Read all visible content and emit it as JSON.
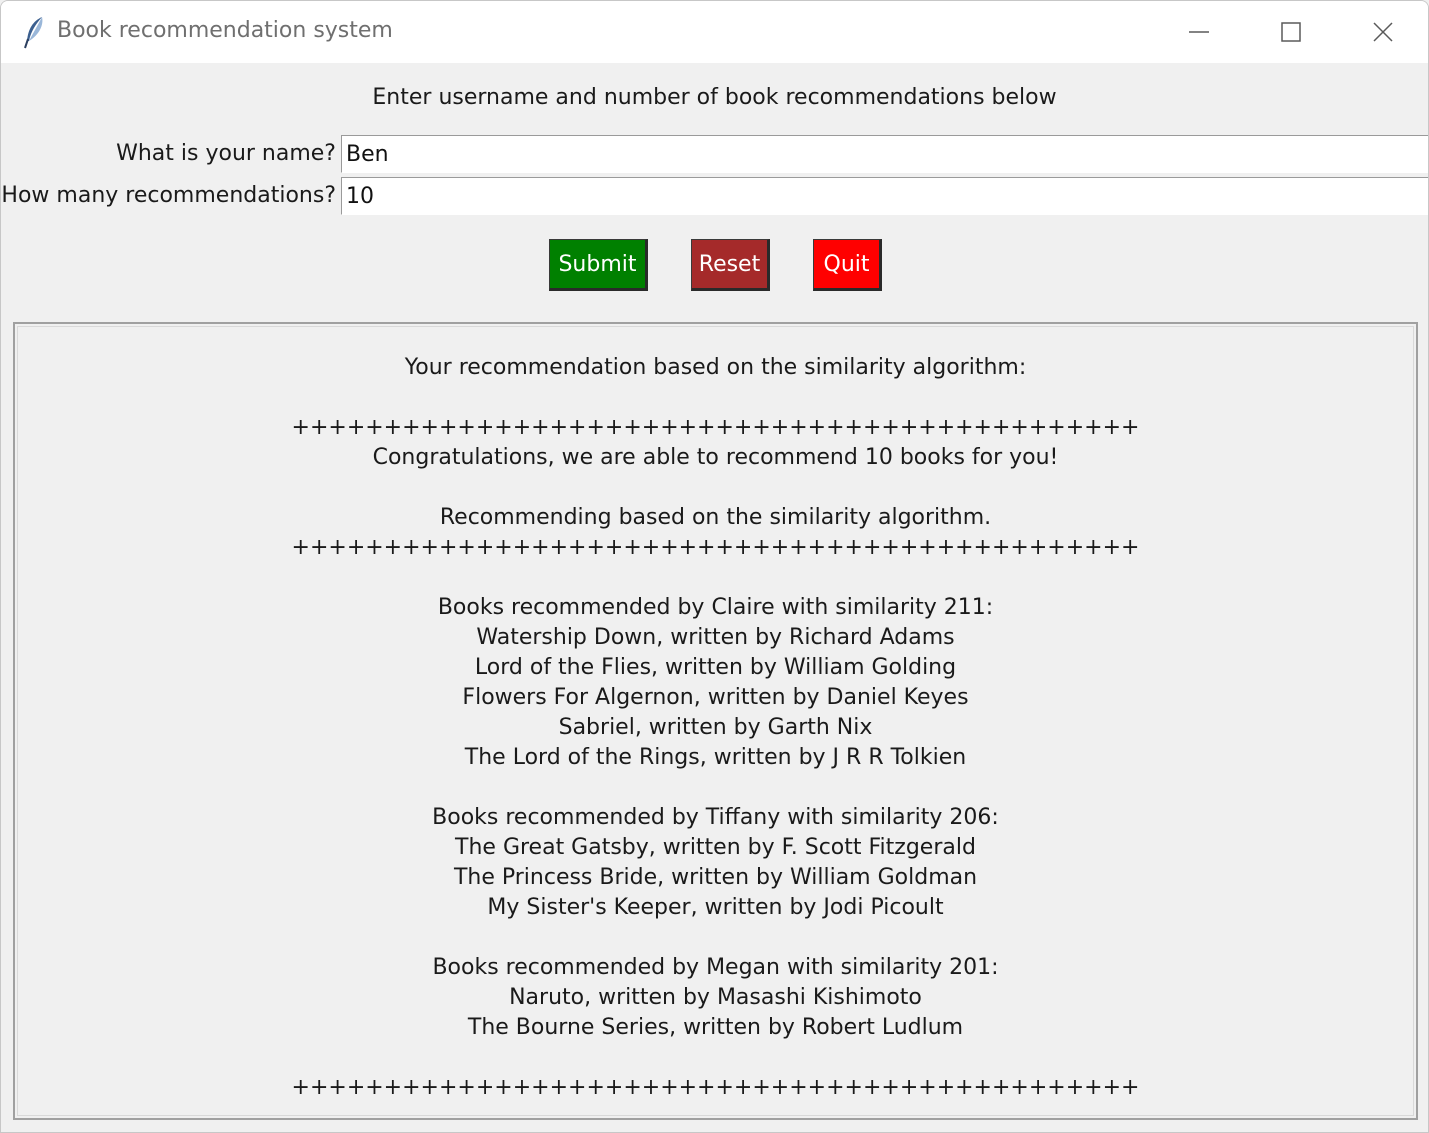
{
  "window": {
    "title": "Book recommendation system",
    "icon": "feather-icon",
    "controls": [
      "minimize-icon",
      "maximize-icon",
      "close-icon"
    ]
  },
  "form": {
    "instructions": "Enter username and number of book recommendations below",
    "name_label": "What is your name?",
    "name_value": "Ben",
    "count_label": "How many recommendations?",
    "count_value": "10"
  },
  "buttons": {
    "submit_label": "Submit",
    "reset_label": "Reset",
    "quit_label": "Quit",
    "submit_color": "#008000",
    "reset_color": "#a52a2a",
    "quit_color": "#ff0000"
  },
  "results": {
    "lines": [
      "Your recommendation based on the similarity algorithm:",
      "",
      "++++++++++++++++++++++++++++++++++++++++++++++",
      "Congratulations, we are able to recommend 10 books for you!",
      "",
      "Recommending based on the similarity algorithm.",
      "++++++++++++++++++++++++++++++++++++++++++++++",
      "",
      "Books recommended by Claire with similarity 211:",
      "Watership Down, written by Richard Adams",
      "Lord of the Flies, written by William Golding",
      "Flowers For Algernon, written by Daniel Keyes",
      "Sabriel, written by Garth Nix",
      "The Lord of the Rings, written by J R R Tolkien",
      "",
      "Books recommended by Tiffany with similarity 206:",
      "The Great Gatsby, written by F. Scott Fitzgerald",
      "The Princess Bride, written by William Goldman",
      "My Sister's Keeper, written by Jodi Picoult",
      "",
      "Books recommended by Megan with similarity 201:",
      "Naruto, written by Masashi Kishimoto",
      "The Bourne Series, written by Robert Ludlum",
      "",
      "++++++++++++++++++++++++++++++++++++++++++++++"
    ]
  }
}
